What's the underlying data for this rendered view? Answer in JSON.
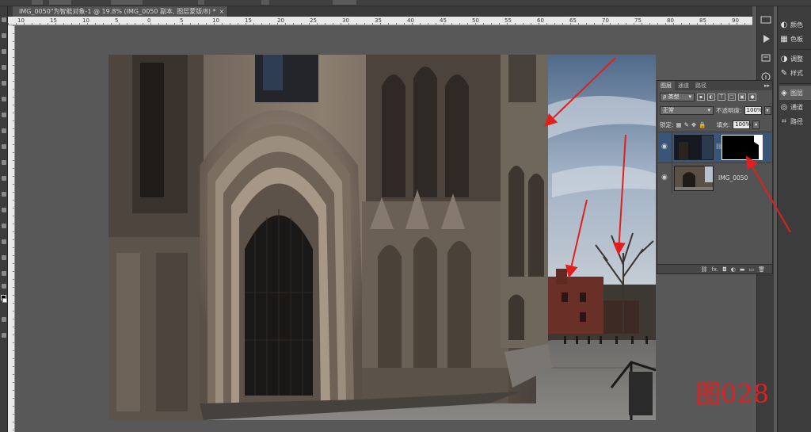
{
  "document_tab": {
    "title": "IMG_0050\"为智能对象-1 @ 19.8% (IMG_0050 副本, 图层蒙版/8) *",
    "close_glyph": "×"
  },
  "ruler_numbers": [
    "10",
    "15",
    "10",
    "5",
    "0",
    "5",
    "10",
    "15",
    "20",
    "25",
    "30",
    "35",
    "40",
    "45",
    "50",
    "55",
    "60",
    "65",
    "70",
    "75",
    "80",
    "85",
    "90"
  ],
  "dock": {
    "items": [
      {
        "label": "颜色",
        "icon": "color-wheel-icon"
      },
      {
        "label": "色板",
        "icon": "swatches-grid-icon"
      },
      {
        "label": "调整",
        "icon": "adjustments-icon"
      },
      {
        "label": "样式",
        "icon": "styles-icon"
      },
      {
        "label": "图层",
        "icon": "layers-icon"
      },
      {
        "label": "通道",
        "icon": "channels-icon"
      },
      {
        "label": "路径",
        "icon": "paths-icon"
      }
    ]
  },
  "layers_panel": {
    "tabs": [
      "图层",
      "通道",
      "路径"
    ],
    "collapse_glyph": "▸▸",
    "filter_kind": "ρ 类型",
    "blend_mode": "正常",
    "opacity_label": "不透明度:",
    "opacity_value": "100%",
    "lock_label": "锁定:",
    "fill_label": "填充:",
    "fill_value": "100%",
    "layers": [
      {
        "name": "",
        "has_mask": true,
        "selected": true
      },
      {
        "name": "IMG_0050",
        "has_mask": false,
        "selected": false
      }
    ],
    "footer_icons": [
      "link-icon",
      "fx-icon",
      "mask-icon",
      "adjustment-icon",
      "group-icon",
      "new-layer-icon",
      "trash-icon"
    ],
    "footer_glyphs": [
      "⛓",
      "fx.",
      "◘",
      "◐",
      "▬",
      "▭",
      "🗑"
    ]
  },
  "figure_label": "图028",
  "colors": {
    "arrow": "#e0201e",
    "selection": "#39567a",
    "panel": "#535353"
  }
}
